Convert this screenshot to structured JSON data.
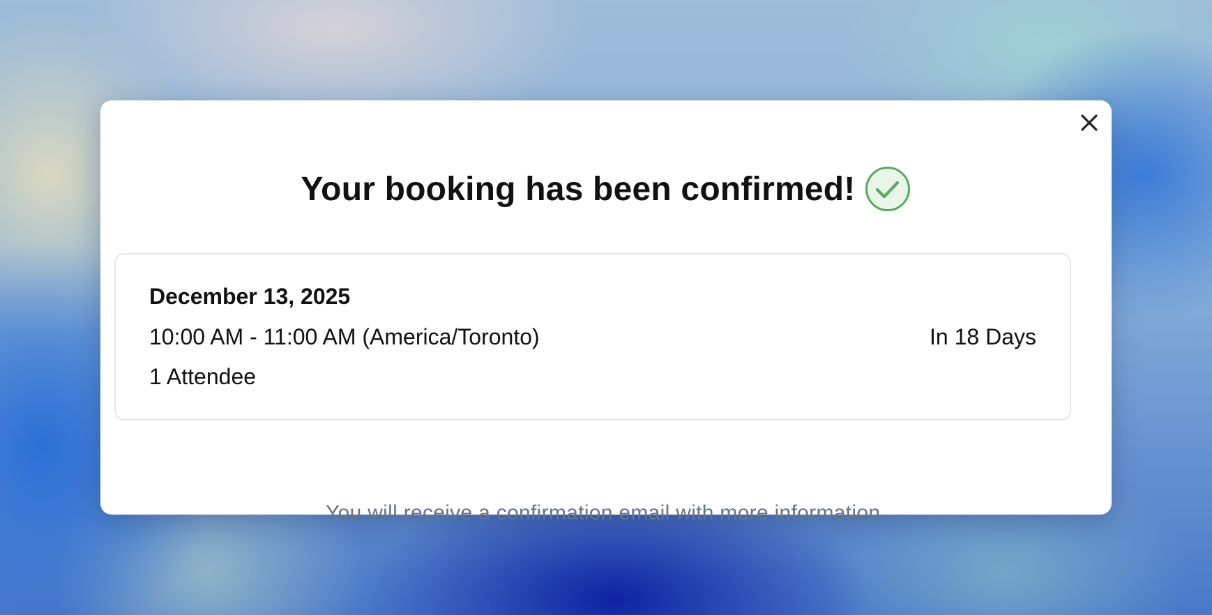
{
  "dialog": {
    "title": "Your booking has been confirmed!",
    "status_icon": "check-circle-icon",
    "close_icon": "close-icon",
    "accent_color": "#5aa85e",
    "accent_fill": "#eaf5ea"
  },
  "booking": {
    "date": "December 13, 2025",
    "time_range": "10:00 AM - 11:00 AM (America/Toronto)",
    "relative_time": "In 18 Days",
    "attendees": "1 Attendee"
  },
  "footer": {
    "note": "You will receive a confirmation email with more information."
  }
}
